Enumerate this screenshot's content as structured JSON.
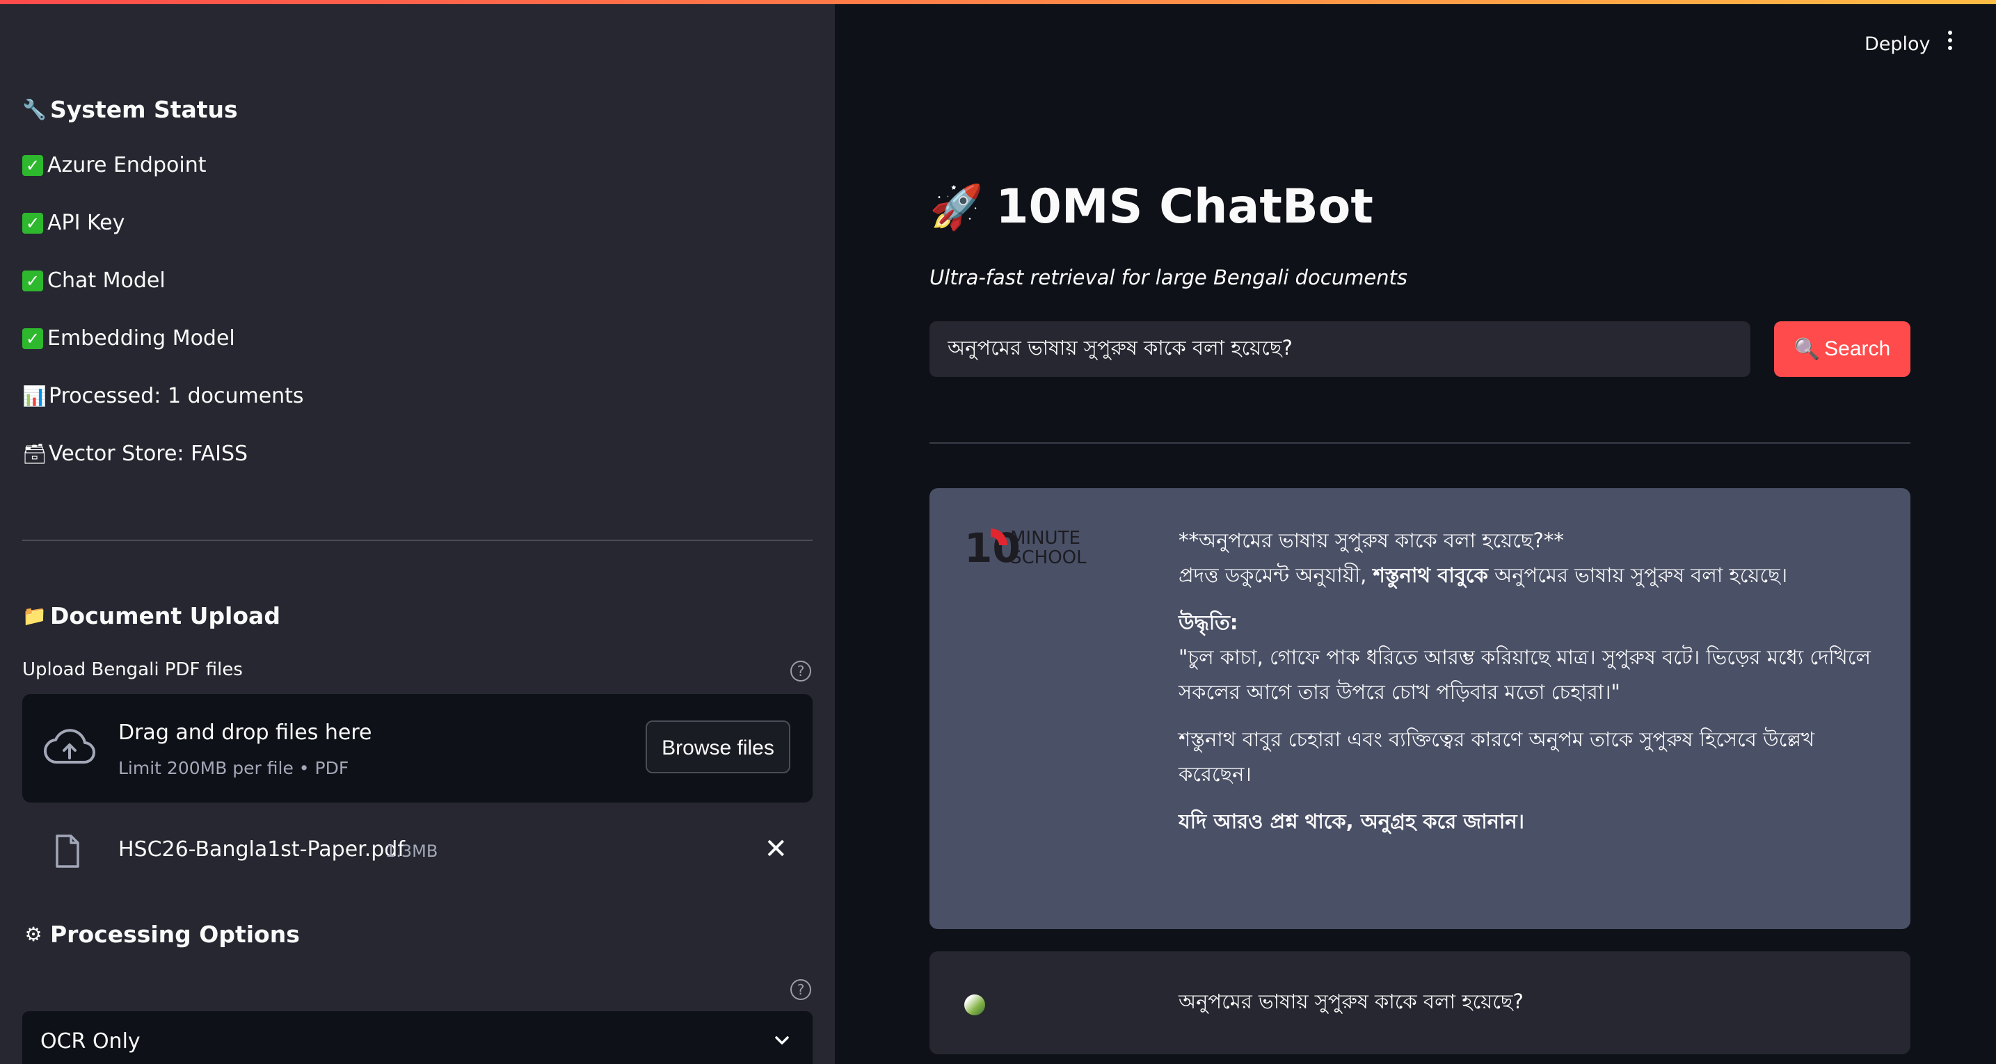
{
  "sidebar": {
    "system_status": {
      "icon": "wrench-icon",
      "title": "System Status"
    },
    "status_items": [
      {
        "icon": "check-icon",
        "label": "Azure Endpoint"
      },
      {
        "icon": "check-icon",
        "label": "API Key"
      },
      {
        "icon": "check-icon",
        "label": "Chat Model"
      },
      {
        "icon": "check-icon",
        "label": "Embedding Model"
      },
      {
        "icon": "bar-chart-icon",
        "label": "Processed: 1 documents"
      },
      {
        "icon": "card-box-icon",
        "label": "Vector Store: FAISS"
      }
    ],
    "document_upload": {
      "icon": "folder-icon",
      "title": "Document Upload",
      "label": "Upload Bengali PDF files",
      "dropzone_title": "Drag and drop files here",
      "dropzone_sub": "Limit 200MB per file • PDF",
      "browse_label": "Browse files",
      "file": {
        "name": "HSC26-Bangla1st-Paper.pdf",
        "size": "1.3MB"
      }
    },
    "processing": {
      "icon": "gear-icon",
      "title": "Processing Options",
      "selected": "OCR Only"
    }
  },
  "header": {
    "deploy_label": "Deploy"
  },
  "main": {
    "title": "10MS ChatBot",
    "subtitle": "Ultra-fast retrieval for large Bengali documents",
    "search_value": "অনুপমের ভাষায় সুপুরুষ কাকে বলা হয়েছে?",
    "search_button": "Search",
    "answer": {
      "logo": {
        "text_1": "10",
        "text_2": "MINUTE",
        "text_3": "SCHOOL"
      },
      "question_line": "**অনুপমের ভাষায় সুপুরুষ কাকে বলা হয়েছে?**",
      "line2_pre": "প্রদত্ত ডকুমেন্ট অনুযায়ী, ",
      "line2_bold": "শস্তুনাথ বাবুকে",
      "line2_post": " অনুপমের ভাষায় সুপুরুষ বলা হয়েছে।",
      "quote_heading": "উদ্ধৃতি:",
      "quote": "\"চুল কাচা, গোফে পাক ধরিতে আরম্ভ করিয়াছে মাত্র। সুপুরুষ বটে। ভিড়ের মধ্যে দেখিলে সকলের আগে তার উপরে চোখ পড়িবার মতো চেহারা।\"",
      "explanation": "শস্তুনাথ বাবুর চেহারা এবং ব্যক্তিত্বের কারণে অনুপম তাকে সুপুরুষ হিসেবে উল্লেখ করেছেন।",
      "closing": "যদি আরও প্রশ্ন থাকে, অনুগ্রহ করে জানান।"
    },
    "query": "অনুপমের ভাষায় সুপুরুষ কাকে বলা হয়েছে?"
  }
}
